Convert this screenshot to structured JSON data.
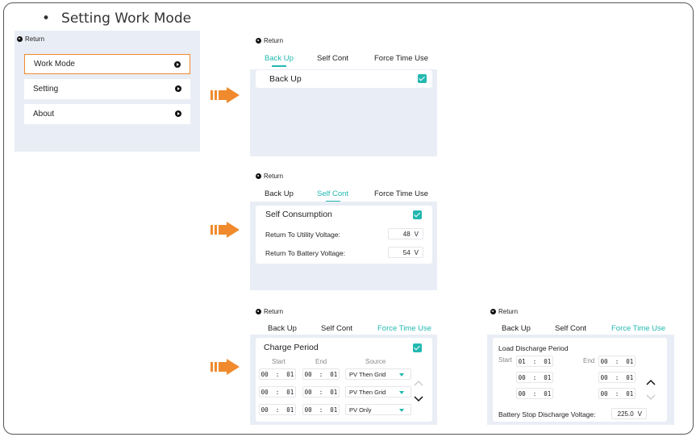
{
  "heading": {
    "bullet": "•",
    "text": "Setting Work Mode"
  },
  "common": {
    "return_label": "Return"
  },
  "menu": {
    "items": [
      {
        "label": "Work Mode"
      },
      {
        "label": "Setting"
      },
      {
        "label": "About"
      }
    ]
  },
  "tabs": {
    "back_up": "Back Up",
    "self_cont": "Self Cont",
    "force_time_use": "Force Time Use"
  },
  "backup_screen": {
    "label": "Back Up",
    "checked": true
  },
  "self_consumption_screen": {
    "title": "Self Consumption",
    "rows": [
      {
        "label": "Return To Utility Voltage:",
        "value": "48",
        "unit": "V"
      },
      {
        "label": "Return To Battery Voltage:",
        "value": "54",
        "unit": "V"
      }
    ]
  },
  "charge_screen": {
    "title": "Charge Period",
    "col_start": "Start",
    "col_end": "End",
    "col_source": "Source",
    "rows": [
      {
        "start": "00  :  01",
        "end": "00  :  01",
        "source": "PV Then Grid"
      },
      {
        "start": "00  :  01",
        "end": "00  :  01",
        "source": "PV Then Grid"
      },
      {
        "start": "00  :  01",
        "end": "00  :  01",
        "source": "PV Only"
      }
    ]
  },
  "discharge_screen": {
    "title": "Load Discharge Period",
    "start_label": "Start",
    "end_label": "End",
    "rows": [
      {
        "start": "01  :  01",
        "end": "00  :  01"
      },
      {
        "start": "00  :  01",
        "end": "00  :  01"
      },
      {
        "start": "00  :  01",
        "end": "00  :  01"
      }
    ],
    "voltage_label": "Battery Stop Discharge Voltage:",
    "voltage_value": "225.0",
    "voltage_unit": "V"
  },
  "colors": {
    "accent": "#22b8b0",
    "highlight": "#f08a2c",
    "panel": "#e9edf5"
  }
}
